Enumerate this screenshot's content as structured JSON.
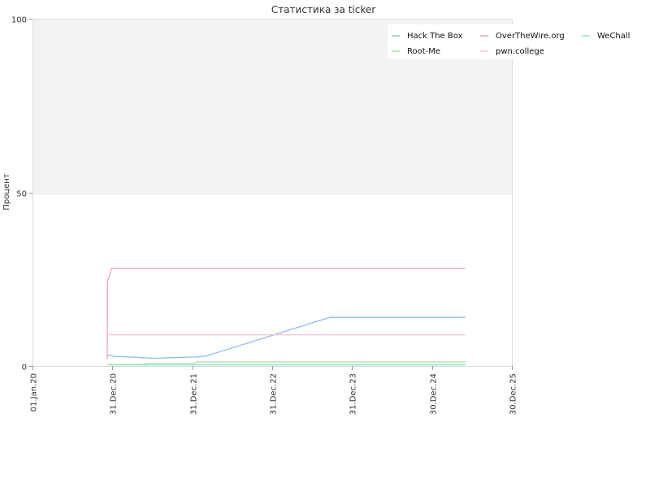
{
  "chart_data": {
    "type": "line",
    "title": "Статистика за ticker",
    "xlabel": "",
    "ylabel": "Процент",
    "ylim": [
      0,
      100
    ],
    "yticks": [
      0,
      50,
      100
    ],
    "xlim": [
      "2020-01-01",
      "2025-12-30"
    ],
    "xticks": [
      {
        "date": "2020-01-01",
        "label": "01.Jan.20"
      },
      {
        "date": "2020-12-31",
        "label": "31.Dec.20"
      },
      {
        "date": "2021-12-31",
        "label": "31.Dec.21"
      },
      {
        "date": "2022-12-31",
        "label": "31.Dec.22"
      },
      {
        "date": "2023-12-31",
        "label": "31.Dec.23"
      },
      {
        "date": "2024-12-30",
        "label": "30.Dec.24"
      },
      {
        "date": "2025-12-30",
        "label": "30.Dec.25"
      }
    ],
    "shaded_band": {
      "from": 50,
      "to": 100,
      "color": "#f3f3f3"
    },
    "grid": true,
    "legend_position": "top-right",
    "series": [
      {
        "name": "Hack The Box",
        "color": "#8fbbf0",
        "points": [
          [
            "2020-12-09",
            3.0
          ],
          [
            "2020-12-25",
            3.0
          ],
          [
            "2021-01-05",
            2.8
          ],
          [
            "2021-04-20",
            2.5
          ],
          [
            "2021-07-10",
            2.2
          ],
          [
            "2021-09-20",
            2.4
          ],
          [
            "2022-01-15",
            2.6
          ],
          [
            "2022-03-01",
            2.8
          ],
          [
            "2023-09-20",
            14.0
          ],
          [
            "2025-06-01",
            14.0
          ]
        ]
      },
      {
        "name": "OverTheWire.org",
        "color": "#e8a3c4",
        "points": [
          [
            "2020-12-07",
            2.0
          ],
          [
            "2020-12-09",
            24.5
          ],
          [
            "2020-12-15",
            25.5
          ],
          [
            "2020-12-21",
            26.5
          ],
          [
            "2020-12-25",
            28.0
          ],
          [
            "2025-06-01",
            28.0
          ]
        ]
      },
      {
        "name": "WeChall",
        "color": "#8fe0d0",
        "points": [
          [
            "2020-12-09",
            0.3
          ],
          [
            "2025-06-01",
            0.3
          ]
        ]
      },
      {
        "name": "Root-Me",
        "color": "#a6e3a6",
        "points": [
          [
            "2020-12-09",
            0.4
          ],
          [
            "2021-05-20",
            0.5
          ],
          [
            "2021-06-10",
            0.8
          ],
          [
            "2022-01-15",
            0.8
          ],
          [
            "2022-01-20",
            1.2
          ],
          [
            "2025-06-01",
            1.2
          ]
        ]
      },
      {
        "name": "pwn.college",
        "color": "#f5c2cc",
        "points": [
          [
            "2020-12-09",
            9.0
          ],
          [
            "2025-06-01",
            9.0
          ]
        ]
      }
    ]
  }
}
